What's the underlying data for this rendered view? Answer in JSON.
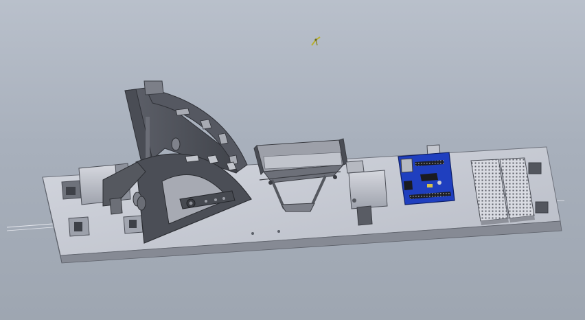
{
  "viewport": {
    "background_top": "#b9c0cb",
    "background_bottom": "#9ea6b1"
  },
  "scene": {
    "content": "3d-cad-assembly",
    "parts": [
      "base-plate",
      "quadrant-arm-back",
      "quadrant-arm-front",
      "hopper",
      "servo-block",
      "arduino-board",
      "breadboard-left",
      "breadboard-right",
      "side-brackets"
    ]
  },
  "colors": {
    "plate_top": "#c9ccd6",
    "plate_front": "#8a8e98",
    "part_dark": "#4f525a",
    "part_mid": "#8a8d96",
    "part_light": "#c7cad2",
    "arduino_blue": "#1f3fbf",
    "breadboard_light": "#d9dbe2",
    "triad_yellow": "#b8b030"
  },
  "icons": {
    "triad": "coordinate-triad-icon"
  }
}
